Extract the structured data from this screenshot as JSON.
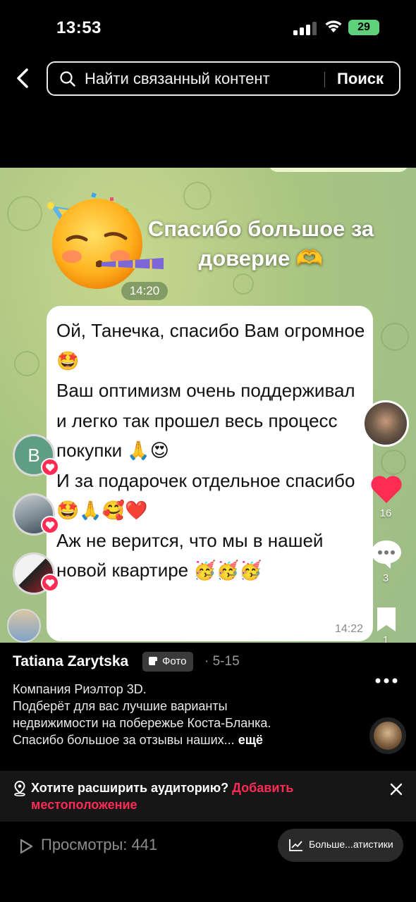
{
  "status_bar": {
    "time": "13:53",
    "battery": "29"
  },
  "search": {
    "placeholder": "Найти связанный контент",
    "button_label": "Поиск"
  },
  "chat": {
    "sticker_text": "Спасибо большое за доверие 🫶",
    "sticker_time": "14:20",
    "message_text": "Ой, Танечка, спасибо Вам огромное 🤩\nВаш оптимизм очень поддерживал и легко так прошел весь процесс покупки 🙏😍\nИ за подарочек отдельное спасибо 🤩🙏🥰❤️\nАж не верится, что мы в нашей новой квартире 🥳🥳🥳",
    "message_time": "14:22",
    "avatar_letter": "В"
  },
  "actions": {
    "likes": "16",
    "comments": "3",
    "saves": "1"
  },
  "post": {
    "author": "Tatiana Zarytska",
    "tag": "Фото",
    "date": "· 5-15",
    "caption": "Компания  Риэлтор 3D.\nПодберёт для вас лучшие варианты недвижимости на побережье Коста-Бланка.\nСпасибо большое за отзывы наших...",
    "more_label": "ещё"
  },
  "location_prompt": {
    "text": "Хотите расширить аудиторию?",
    "link": "Добавить местоположение"
  },
  "bottom": {
    "views": "Просмотры: 441",
    "stats_button": "Больше...атистики"
  },
  "colors": {
    "accent": "#fe2c55",
    "battery": "#5ed17a",
    "chat_bg": "#a9c482"
  }
}
